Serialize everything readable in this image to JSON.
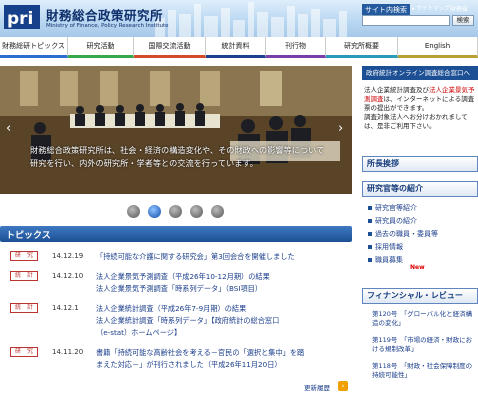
{
  "header": {
    "logo_text": "pri",
    "title": "財務総合政策研究所",
    "subtitle": "Ministry of Finance, Policy Research Institute",
    "search_label": "サイト内検索",
    "sitemap": "▸ サイトマップ",
    "mof": "財務省",
    "search_button": "検索",
    "search_value": ""
  },
  "nav": {
    "items": [
      {
        "label": "財務総研トピックス",
        "color": "#2a6fd0"
      },
      {
        "label": "研究活動",
        "color": "#37a84a"
      },
      {
        "label": "国際交流活動",
        "color": "#d44b2a"
      },
      {
        "label": "統計資料",
        "color": "#1c3f8f"
      },
      {
        "label": "刊行物",
        "color": "#7a3ea8"
      },
      {
        "label": "研究所概要",
        "color": "#2a9ab8"
      },
      {
        "label": "English",
        "color": "#b8a032"
      }
    ]
  },
  "banner": {
    "caption": "財務総合政策研究所は、社会・経済の構造変化や、その財政への影響等について研究を行い、内外の研究所・学者等との交流を行っています。",
    "prev": "‹",
    "next": "›",
    "active_slide": 2,
    "slide_count": 5
  },
  "topics": {
    "title": "トピックス",
    "items": [
      {
        "badge": "研　究",
        "date": "14.12.19",
        "lines": [
          "「持続可能な介護に関する研究会」第3回会合を開催しました"
        ]
      },
      {
        "badge": "統　計",
        "date": "14.12.10",
        "lines": [
          "法人企業景気予測調査（平成26年10-12月期）の結果",
          "法人企業景気予測調査「時系列データ」（BSI項目）"
        ]
      },
      {
        "badge": "統　計",
        "date": "14.12.1",
        "lines": [
          "法人企業統計調査（平成26年7-9月期）の結果",
          "法人企業統計調査「時系列データ」【政府統計の総合窓口",
          "（e-stat）ホームページ】"
        ]
      },
      {
        "badge": "研　究",
        "date": "14.11.20",
        "lines": [
          "書籍「持続可能な高齢社会を考える－官民の「選択と集中」を踏",
          "まえた対応－」が刊行されました（平成26年11月20日）"
        ]
      }
    ],
    "more": "更新履歴"
  },
  "sidebar": {
    "notice_bar": "政府統計オンライン調査総合窓口へ",
    "notice_text_plain": "法人企業統計調査及び",
    "notice_text_red": "法人企業景気予測調査",
    "notice_text_rest": "は、インターネットによる調査票の提出ができます。",
    "notice_text2": "調査対象法人へお分けおかれましては、是非ご利用下さい。",
    "greeting": "所長挨拶",
    "staff_title": "研究官等の紹介",
    "staff_items": [
      "研究官等紹介",
      "研究員の紹介",
      "過去の職員・委員等",
      "採用情報",
      "職員募集"
    ],
    "new_label": "New",
    "financial_title": "フィナンシャル・レビュー",
    "financial_items": [
      "第120号　「グローバル化と経済構造の変化」",
      "第119号　「市場の経済・財政における規制改革」",
      "第118号　「財政・社会保障制度の持続可能性」"
    ]
  }
}
